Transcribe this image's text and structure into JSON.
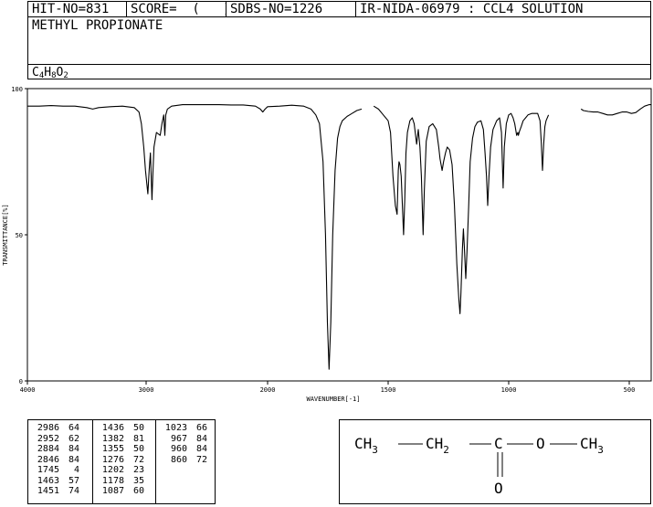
{
  "header": {
    "hit_no": "HIT-NO=831",
    "score": "SCORE=  (   )",
    "sdbs_no": "SDBS-NO=1226",
    "ir_info": "IR-NIDA-06979 : CCL4 SOLUTION",
    "compound_name": "METHYL PROPIONATE",
    "formula": {
      "base": [
        "C",
        "H",
        "O"
      ],
      "subs": [
        "4",
        "8",
        "2"
      ]
    }
  },
  "chart_data": {
    "type": "line",
    "title": "",
    "xlabel": "WAVENUMBER[-1]",
    "ylabel": "TRANSMITTANCE[%]",
    "xlim": [
      4000,
      400
    ],
    "ylim": [
      0,
      100
    ],
    "x_ticks": [
      4000,
      3000,
      2000,
      1500,
      1000,
      500
    ],
    "y_ticks": [
      100,
      50,
      0
    ],
    "line_color": "#000000",
    "series": [
      {
        "points": [
          [
            4000,
            94
          ],
          [
            3900,
            94
          ],
          [
            3800,
            94.2
          ],
          [
            3700,
            94
          ],
          [
            3600,
            94
          ],
          [
            3500,
            93.5
          ],
          [
            3450,
            93
          ],
          [
            3400,
            93.5
          ],
          [
            3300,
            93.8
          ],
          [
            3200,
            94
          ],
          [
            3100,
            93.5
          ],
          [
            3060,
            92
          ],
          [
            3040,
            88
          ],
          [
            3020,
            80
          ],
          [
            3005,
            72
          ],
          [
            2986,
            64
          ],
          [
            2975,
            72
          ],
          [
            2965,
            78
          ],
          [
            2952,
            62
          ],
          [
            2945,
            70
          ],
          [
            2935,
            80
          ],
          [
            2915,
            85
          ],
          [
            2884,
            84
          ],
          [
            2870,
            88
          ],
          [
            2855,
            91
          ],
          [
            2846,
            84
          ],
          [
            2838,
            91
          ],
          [
            2825,
            93
          ],
          [
            2790,
            94
          ],
          [
            2700,
            94.5
          ],
          [
            2600,
            94.5
          ],
          [
            2500,
            94.5
          ],
          [
            2400,
            94.5
          ],
          [
            2300,
            94.4
          ],
          [
            2200,
            94.4
          ],
          [
            2100,
            94
          ],
          [
            2060,
            93
          ],
          [
            2040,
            92
          ],
          [
            2020,
            93
          ],
          [
            2000,
            93.8
          ],
          [
            1950,
            94
          ],
          [
            1900,
            94.3
          ],
          [
            1850,
            94
          ],
          [
            1820,
            93
          ],
          [
            1800,
            91
          ],
          [
            1785,
            88
          ],
          [
            1770,
            75
          ],
          [
            1760,
            50
          ],
          [
            1752,
            20
          ],
          [
            1745,
            4
          ],
          [
            1738,
            20
          ],
          [
            1730,
            50
          ],
          [
            1720,
            72
          ],
          [
            1710,
            83
          ],
          [
            1700,
            87
          ],
          [
            1690,
            89
          ],
          [
            1670,
            90.5
          ],
          [
            1650,
            91.5
          ],
          [
            1630,
            92.5
          ],
          [
            1610,
            93
          ]
        ]
      },
      {
        "points": [
          [
            1560,
            94
          ],
          [
            1540,
            93
          ],
          [
            1520,
            91
          ],
          [
            1500,
            89
          ],
          [
            1490,
            85
          ],
          [
            1480,
            70
          ],
          [
            1470,
            60
          ],
          [
            1463,
            57
          ],
          [
            1458,
            72
          ],
          [
            1455,
            75
          ],
          [
            1451,
            74
          ],
          [
            1446,
            70
          ],
          [
            1441,
            60
          ],
          [
            1436,
            50
          ],
          [
            1431,
            62
          ],
          [
            1426,
            78
          ],
          [
            1420,
            85
          ],
          [
            1410,
            89
          ],
          [
            1400,
            90
          ],
          [
            1392,
            88
          ],
          [
            1382,
            81
          ],
          [
            1375,
            86
          ],
          [
            1368,
            80
          ],
          [
            1362,
            70
          ],
          [
            1355,
            50
          ],
          [
            1350,
            65
          ],
          [
            1342,
            82
          ],
          [
            1330,
            87
          ],
          [
            1315,
            88
          ],
          [
            1300,
            86
          ],
          [
            1290,
            80
          ],
          [
            1285,
            76
          ],
          [
            1276,
            72
          ],
          [
            1270,
            75
          ],
          [
            1262,
            78
          ],
          [
            1255,
            80
          ],
          [
            1245,
            79
          ],
          [
            1235,
            74
          ],
          [
            1225,
            60
          ],
          [
            1215,
            40
          ],
          [
            1207,
            28
          ],
          [
            1202,
            23
          ],
          [
            1198,
            30
          ],
          [
            1192,
            45
          ],
          [
            1188,
            52
          ],
          [
            1184,
            46
          ],
          [
            1178,
            35
          ],
          [
            1173,
            44
          ],
          [
            1166,
            60
          ],
          [
            1160,
            75
          ],
          [
            1150,
            83
          ],
          [
            1140,
            87
          ],
          [
            1130,
            88.5
          ],
          [
            1115,
            89
          ],
          [
            1105,
            86
          ],
          [
            1098,
            78
          ],
          [
            1092,
            70
          ],
          [
            1087,
            60
          ],
          [
            1082,
            70
          ],
          [
            1075,
            80
          ],
          [
            1065,
            86
          ],
          [
            1050,
            89
          ],
          [
            1038,
            90
          ],
          [
            1030,
            85
          ],
          [
            1023,
            66
          ],
          [
            1018,
            80
          ],
          [
            1010,
            88
          ],
          [
            1000,
            91
          ],
          [
            990,
            91.5
          ],
          [
            982,
            90
          ],
          [
            975,
            88
          ],
          [
            967,
            84
          ],
          [
            962,
            85
          ],
          [
            960,
            84
          ],
          [
            955,
            85.5
          ],
          [
            948,
            87
          ],
          [
            940,
            89
          ],
          [
            930,
            90
          ],
          [
            920,
            91
          ],
          [
            905,
            91.5
          ],
          [
            890,
            91.5
          ],
          [
            880,
            91.5
          ],
          [
            870,
            89
          ],
          [
            865,
            82
          ],
          [
            860,
            72
          ],
          [
            855,
            81
          ],
          [
            850,
            87
          ],
          [
            845,
            89
          ],
          [
            835,
            91
          ]
        ]
      },
      {
        "points": [
          [
            700,
            93
          ],
          [
            690,
            92.5
          ],
          [
            670,
            92.2
          ],
          [
            650,
            92
          ],
          [
            630,
            92
          ],
          [
            610,
            91.5
          ],
          [
            590,
            91
          ],
          [
            570,
            91
          ],
          [
            550,
            91.5
          ],
          [
            530,
            92
          ],
          [
            510,
            92
          ],
          [
            490,
            91.5
          ],
          [
            470,
            91.8
          ],
          [
            450,
            93
          ],
          [
            430,
            94
          ],
          [
            410,
            94.5
          ],
          [
            400,
            94.5
          ]
        ]
      }
    ]
  },
  "peak_table": {
    "columns": [
      [
        [
          "2986",
          "64"
        ],
        [
          "2952",
          "62"
        ],
        [
          "2884",
          "84"
        ],
        [
          "2846",
          "84"
        ],
        [
          "1745",
          "4"
        ],
        [
          "1463",
          "57"
        ],
        [
          "1451",
          "74"
        ]
      ],
      [
        [
          "1436",
          "50"
        ],
        [
          "1382",
          "81"
        ],
        [
          "1355",
          "50"
        ],
        [
          "1276",
          "72"
        ],
        [
          "1202",
          "23"
        ],
        [
          "1178",
          "35"
        ],
        [
          "1087",
          "60"
        ]
      ],
      [
        [
          "1023",
          "66"
        ],
        [
          "967",
          "84"
        ],
        [
          "960",
          "84"
        ],
        [
          "860",
          "72"
        ]
      ]
    ]
  },
  "structure": {
    "groups": [
      "CH",
      "3",
      "CH",
      "2",
      "C",
      "O",
      "CH",
      "3"
    ],
    "carbonyl_o": "O"
  }
}
